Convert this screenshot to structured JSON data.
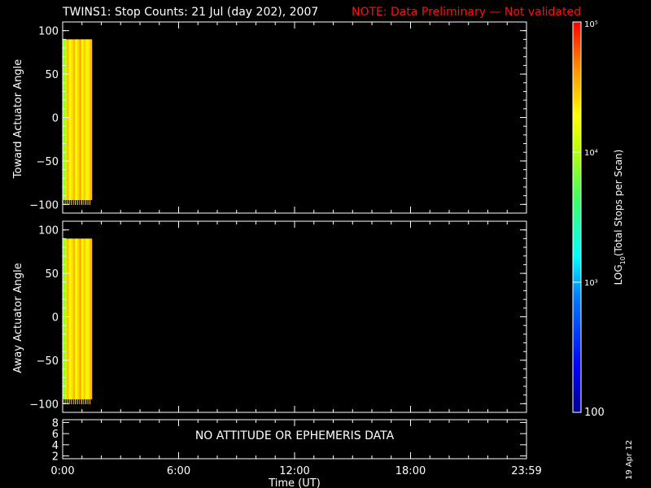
{
  "header": {
    "title": "TWINS1: Stop Counts: 21 Jul (day 202), 2007",
    "note": "NOTE: Data Preliminary — Not validated"
  },
  "footer": {
    "date_stamp": "19 Apr 12"
  },
  "chart_data": [
    {
      "type": "heatmap",
      "ylabel": "Toward Actuator Angle",
      "ylim": [
        -110,
        110
      ],
      "yticks": [
        -100,
        -50,
        0,
        50,
        100
      ],
      "xlim": [
        0,
        24
      ],
      "x_range_hours": [
        0.0,
        1.5
      ],
      "y_range": [
        -95,
        90
      ],
      "value_log10_range": [
        4.2,
        4.55
      ],
      "grid": false
    },
    {
      "type": "heatmap",
      "ylabel": "Away Actuator Angle",
      "ylim": [
        -110,
        110
      ],
      "yticks": [
        -100,
        -50,
        0,
        50,
        100
      ],
      "xlim": [
        0,
        24
      ],
      "x_range_hours": [
        0.0,
        1.5
      ],
      "y_range": [
        -95,
        90
      ],
      "value_log10_range": [
        4.2,
        4.55
      ],
      "grid": false
    },
    {
      "type": "line",
      "ylim": [
        1.5,
        8.5
      ],
      "yticks": [
        2,
        4,
        6,
        8
      ],
      "annotation": "NO ATTITUDE OR EPHEMERIS DATA"
    }
  ],
  "x_axis": {
    "label": "Time (UT)",
    "tick_labels": [
      "0:00",
      "6:00",
      "12:00",
      "18:00",
      "23:59"
    ],
    "tick_hours": [
      0,
      6,
      12,
      18,
      24
    ]
  },
  "colorbar": {
    "label": "LOG10(Total Stops per Scan)",
    "label_prefix": "LOG",
    "label_sub": "10",
    "label_suffix": "(Total Stops per Scan)",
    "tick_labels": [
      "100",
      "10³",
      "10⁴",
      "10⁵"
    ],
    "tick_log10": [
      2,
      3,
      4,
      5
    ],
    "range_log10": [
      2,
      5
    ],
    "colormap": "rainbow"
  },
  "colors": {
    "background": "#000000",
    "axes": "#ffffff",
    "note": "#ff1010"
  }
}
